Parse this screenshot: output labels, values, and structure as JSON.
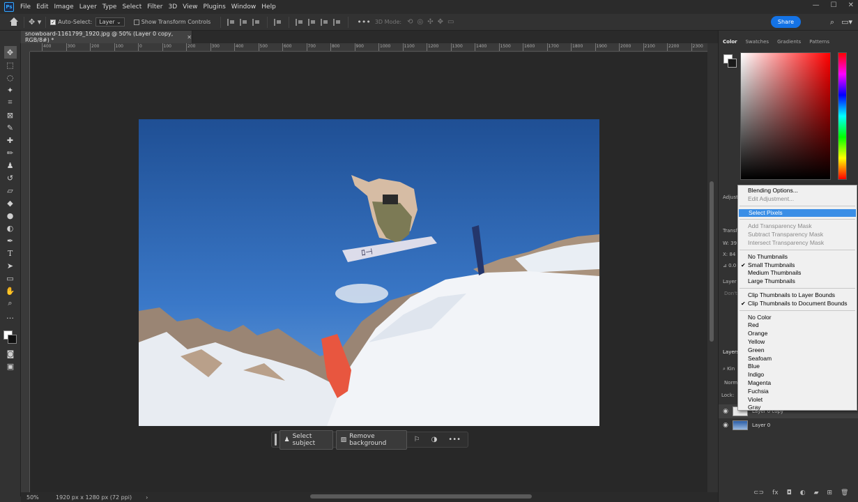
{
  "menubar": {
    "logo": "Ps",
    "items": [
      "File",
      "Edit",
      "Image",
      "Layer",
      "Type",
      "Select",
      "Filter",
      "3D",
      "View",
      "Plugins",
      "Window",
      "Help"
    ],
    "window_controls": [
      "—",
      "☐",
      "✕"
    ]
  },
  "options": {
    "auto_select_label": "Auto-Select:",
    "auto_select_checked": true,
    "auto_select_target": "Layer",
    "show_transform_label": "Show Transform Controls",
    "mode_3d": "3D Mode:",
    "share_label": "Share"
  },
  "document": {
    "tab_title": "snowboard-1161799_1920.jpg @ 50% (Layer 0 copy, RGB/8#) *",
    "zoom": "50%",
    "doc_info": "1920 px x 1280 px (72 ppi)"
  },
  "ruler": {
    "h_labels": [
      "400",
      "300",
      "200",
      "100",
      "0",
      "100",
      "200",
      "300",
      "400",
      "500",
      "600",
      "700",
      "800",
      "900",
      "1000",
      "1100",
      "1200",
      "1300",
      "1400",
      "1500",
      "1600",
      "1700",
      "1800",
      "1900",
      "2000",
      "2100",
      "2200",
      "2300"
    ]
  },
  "context_bar": {
    "select_subject": "Select subject",
    "remove_background": "Remove background"
  },
  "panels": {
    "color_tabs": [
      "Color",
      "Swatches",
      "Gradients",
      "Patterns"
    ],
    "adjust_label": "Adjust",
    "transform_label": "Transf",
    "w_label": "W:",
    "w_value": "39",
    "x_label": "X:",
    "x_value": "84",
    "angle_value": "0.0",
    "layer_comp_label": "Layer C",
    "dont_label": "Don't",
    "layers_tab": "Layers",
    "kind_label": "Kin",
    "blend_mode": "Norma",
    "lock_label": "Lock:",
    "layers": [
      {
        "name": "Layer 0 copy",
        "selected": true
      },
      {
        "name": "Layer 0",
        "selected": false
      }
    ],
    "footer_icons": [
      "link-icon",
      "fx",
      "mask-icon",
      "adjustment-icon",
      "group-icon",
      "new-layer-icon",
      "trash-icon"
    ],
    "footer_fx": "fx"
  },
  "context_menu": {
    "group1": [
      {
        "label": "Blending Options...",
        "disabled": false
      },
      {
        "label": "Edit Adjustment...",
        "disabled": true
      }
    ],
    "group2": [
      {
        "label": "Select Pixels",
        "highlighted": true
      }
    ],
    "group3": [
      {
        "label": "Add Transparency Mask",
        "disabled": true
      },
      {
        "label": "Subtract Transparency Mask",
        "disabled": true
      },
      {
        "label": "Intersect Transparency Mask",
        "disabled": true
      }
    ],
    "group4": [
      {
        "label": "No Thumbnails",
        "checked": false
      },
      {
        "label": "Small Thumbnails",
        "checked": true
      },
      {
        "label": "Medium Thumbnails",
        "checked": false
      },
      {
        "label": "Large Thumbnails",
        "checked": false
      }
    ],
    "group5": [
      {
        "label": "Clip Thumbnails to Layer Bounds",
        "checked": false
      },
      {
        "label": "Clip Thumbnails to Document Bounds",
        "checked": true
      }
    ],
    "group6": [
      "No Color",
      "Red",
      "Orange",
      "Yellow",
      "Green",
      "Seafoam",
      "Blue",
      "Indigo",
      "Magenta",
      "Fuchsia",
      "Violet",
      "Gray"
    ]
  },
  "colors": {
    "share_blue": "#1473e6",
    "menu_highlight": "#3a8ee6",
    "ps_blue": "#31a8ff"
  }
}
